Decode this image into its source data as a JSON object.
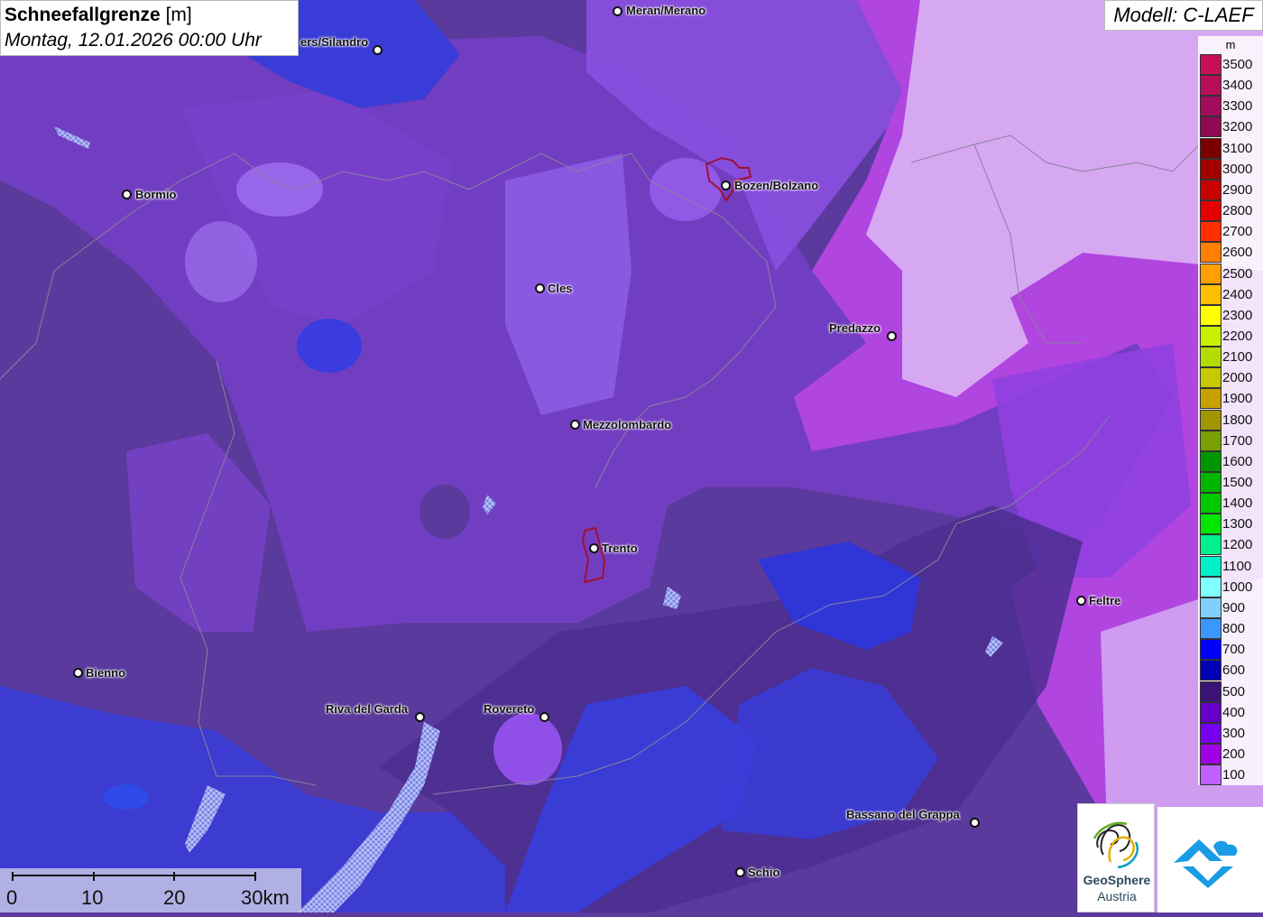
{
  "title": {
    "main": "Schneefallgrenze",
    "unit": "[m]",
    "datetime": "Montag, 12.01.2026 00:00 Uhr"
  },
  "model": "Modell: C-LAEF",
  "legend": {
    "unit": "m",
    "entries": [
      {
        "label": "3500",
        "color": "#c8105a"
      },
      {
        "label": "3400",
        "color": "#b80d58"
      },
      {
        "label": "3300",
        "color": "#a30b5c"
      },
      {
        "label": "3200",
        "color": "#8e0a52"
      },
      {
        "label": "3100",
        "color": "#7a0000"
      },
      {
        "label": "3000",
        "color": "#a30000"
      },
      {
        "label": "2900",
        "color": "#c80000"
      },
      {
        "label": "2800",
        "color": "#e60000"
      },
      {
        "label": "2700",
        "color": "#ff3000"
      },
      {
        "label": "2600",
        "color": "#ff7f00"
      },
      {
        "label": "2500",
        "color": "#ff9f00"
      },
      {
        "label": "2400",
        "color": "#ffbf00"
      },
      {
        "label": "2300",
        "color": "#ffff00"
      },
      {
        "label": "2200",
        "color": "#c8f000"
      },
      {
        "label": "2100",
        "color": "#b4dc00"
      },
      {
        "label": "2000",
        "color": "#c8c800"
      },
      {
        "label": "1900",
        "color": "#c8a000"
      },
      {
        "label": "1800",
        "color": "#a09600"
      },
      {
        "label": "1700",
        "color": "#78a000"
      },
      {
        "label": "1600",
        "color": "#009600"
      },
      {
        "label": "1500",
        "color": "#00b400"
      },
      {
        "label": "1400",
        "color": "#00c800"
      },
      {
        "label": "1300",
        "color": "#00e600"
      },
      {
        "label": "1200",
        "color": "#00f08c"
      },
      {
        "label": "1100",
        "color": "#00f0c8"
      },
      {
        "label": "1000",
        "color": "#80ffff"
      },
      {
        "label": "900",
        "color": "#80d0ff"
      },
      {
        "label": "800",
        "color": "#3c96ff"
      },
      {
        "label": "700",
        "color": "#0000ff"
      },
      {
        "label": "600",
        "color": "#0000b4"
      },
      {
        "label": "500",
        "color": "#3c1478"
      },
      {
        "label": "400",
        "color": "#6400c8"
      },
      {
        "label": "300",
        "color": "#7800f0"
      },
      {
        "label": "200",
        "color": "#a000e6"
      },
      {
        "label": "100",
        "color": "#c060ff"
      }
    ]
  },
  "cities": [
    {
      "name": "Meran/Merano"
    },
    {
      "name": "ers/Silandro"
    },
    {
      "name": "Bormio"
    },
    {
      "name": "Bozen/Bolzano"
    },
    {
      "name": "Cles"
    },
    {
      "name": "Predazzo"
    },
    {
      "name": "Mezzolombardo"
    },
    {
      "name": "Trento"
    },
    {
      "name": "Feltre"
    },
    {
      "name": "Bienno"
    },
    {
      "name": "Riva del Garda"
    },
    {
      "name": "Rovereto"
    },
    {
      "name": "Bassano del Grappa"
    },
    {
      "name": "Schio"
    }
  ],
  "scale": {
    "labels": [
      "0",
      "10",
      "20",
      "30km"
    ]
  },
  "logo": {
    "name_line1": "GeoSphere",
    "name_line2": "Austria"
  }
}
